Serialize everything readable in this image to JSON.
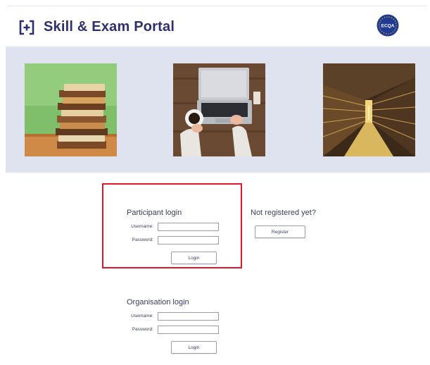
{
  "app": {
    "title": "Skill & Exam Portal",
    "logo_icon": "bracket-plus-icon",
    "badge_label": "ECQA"
  },
  "banner": {
    "images": [
      {
        "name": "stack-of-books-photo"
      },
      {
        "name": "laptop-coffee-photo"
      },
      {
        "name": "library-shelves-photo"
      }
    ]
  },
  "participant_login": {
    "title": "Participant login",
    "username_label": "Username",
    "password_label": "Password",
    "username_value": "",
    "password_value": "",
    "login_button": "Login"
  },
  "register": {
    "prompt": "Not registered yet?",
    "button": "Register"
  },
  "organisation_login": {
    "title": "Organisation login",
    "username_label": "Username",
    "password_label": "Password",
    "username_value": "",
    "password_value": "",
    "login_button": "Login"
  },
  "colors": {
    "brand": "#2e2f6e",
    "banner_bg": "#dfe2ef",
    "highlight": "#e0162b"
  }
}
